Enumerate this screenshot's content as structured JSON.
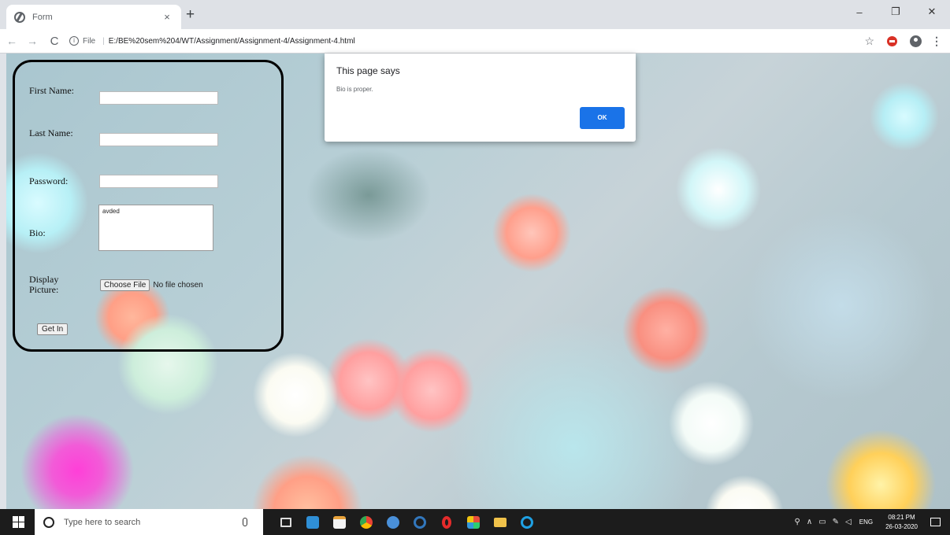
{
  "browser": {
    "tab_title": "Form",
    "tab_close": "×",
    "new_tab": "+",
    "window_controls": {
      "minimize": "–",
      "maximize": "❐",
      "close": "✕"
    },
    "nav": {
      "back": "←",
      "forward": "→",
      "reload": "C"
    },
    "address": {
      "scheme_label": "File",
      "separator": "|",
      "url": "E:/BE%20sem%204/WT/Assignment/Assignment-4/Assignment-4.html"
    },
    "toolbar_icons": {
      "star": "☆",
      "menu": "⋮"
    }
  },
  "form": {
    "first_name_label": "First Name:",
    "first_name_value": "",
    "last_name_label": "Last Name:",
    "last_name_value": "",
    "password_label": "Password:",
    "password_value": "",
    "bio_label": "Bio:",
    "bio_value": "avded",
    "display_picture_label": "Display Picture:",
    "choose_file_button": "Choose File",
    "file_status": "No file chosen",
    "submit_button": "Get In"
  },
  "dialog": {
    "title": "This page says",
    "message": "Bio is proper.",
    "ok_button": "OK"
  },
  "taskbar": {
    "search_placeholder": "Type here to search",
    "tray_lang": "ENG",
    "time": "08:21 PM",
    "date": "26-03-2020"
  }
}
